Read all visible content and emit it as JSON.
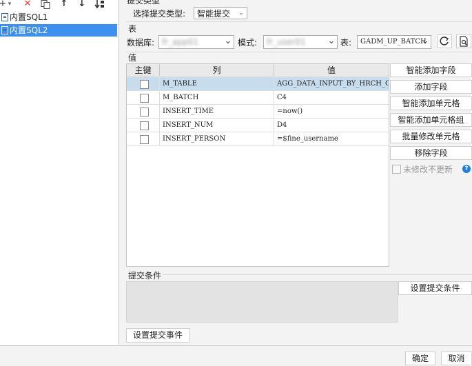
{
  "toolbar": {
    "add": "+",
    "add_dropdown": "▾",
    "delete": "✕",
    "move_up": "↑",
    "move_down": "↓"
  },
  "tree": [
    {
      "label": "内置SQL1",
      "selected": false
    },
    {
      "label": "内置SQL2",
      "selected": true
    }
  ],
  "submit_type": {
    "group_label": "提交类型",
    "label": "选择提交类型:",
    "value": "智能提交"
  },
  "table_section": {
    "title": "表",
    "db_label": "数据库:",
    "db_value": "fr_app01",
    "schema_label": "模式:",
    "schema_value": "fr_user01",
    "table_label": "表:",
    "table_value": "GADM_UP_BATCH"
  },
  "values_section": {
    "title": "值",
    "headers": [
      "主键",
      "列",
      "值"
    ],
    "rows": [
      {
        "key": false,
        "column": "M_TABLE",
        "value": "AGG_DATA_INPUT_BY_HRCH_CNER",
        "selected": true
      },
      {
        "key": false,
        "column": "M_BATCH",
        "value": "C4",
        "selected": false
      },
      {
        "key": false,
        "column": "INSERT_TIME",
        "value": "=now()",
        "selected": false
      },
      {
        "key": false,
        "column": "INSERT_NUM",
        "value": "D4",
        "selected": false
      },
      {
        "key": false,
        "column": "INSERT_PERSON",
        "value": "=$fine_username",
        "selected": false
      }
    ]
  },
  "side_buttons": {
    "smart_add_field": "智能添加字段",
    "add_field": "添加字段",
    "smart_add_cell": "智能添加单元格",
    "smart_add_cell_group": "智能添加单元格组",
    "batch_edit_cell": "批量修改单元格",
    "remove_field": "移除字段",
    "no_update_unchanged": "未修改不更新"
  },
  "condition_section": {
    "title": "提交条件",
    "set_condition": "设置提交条件",
    "set_event": "设置提交事件"
  },
  "footer": {
    "ok": "确定",
    "cancel": "取消"
  },
  "colors": {
    "selection_blue": "#3d8ff0",
    "row_highlight": "#c7dced",
    "delete_red": "#e53935",
    "help_blue": "#1f7fe0"
  },
  "icons": {
    "refresh": "refresh-icon",
    "preview": "preview-icon"
  }
}
